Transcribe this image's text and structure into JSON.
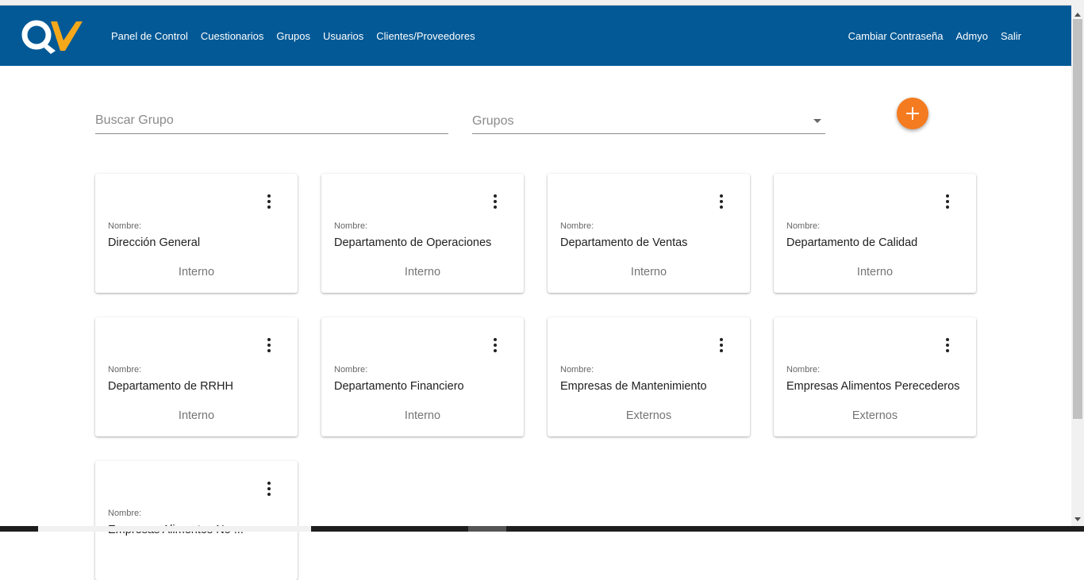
{
  "app": {
    "logo_text": "QV"
  },
  "nav": {
    "links": [
      "Panel de Control",
      "Cuestionarios",
      "Grupos",
      "Usuarios",
      "Clientes/Proveedores"
    ],
    "right": [
      "Cambiar Contraseña",
      "Admyo",
      "Salir"
    ]
  },
  "search": {
    "placeholder": "Buscar Grupo"
  },
  "filter": {
    "placeholder": "Grupos"
  },
  "add_button": {
    "icon": "plus-icon"
  },
  "card_field_label": "Nombre:",
  "groups": [
    {
      "name": "Dirección General",
      "type": "Interno"
    },
    {
      "name": "Departamento de Operaciones",
      "type": "Interno"
    },
    {
      "name": "Departamento de Ventas",
      "type": "Interno"
    },
    {
      "name": "Departamento de Calidad",
      "type": "Interno"
    },
    {
      "name": "Departamento de RRHH",
      "type": "Interno"
    },
    {
      "name": "Departamento Financiero",
      "type": "Interno"
    },
    {
      "name": "Empresas de Mantenimiento",
      "type": "Externos"
    },
    {
      "name": "Empresas Alimentos Perecederos",
      "type": "Externos"
    },
    {
      "name": "Empresas Alimentos No ...",
      "type": ""
    }
  ],
  "colors": {
    "navbar": "#035996",
    "accent": "#f47b20",
    "logo_v": "#f6a81b"
  }
}
